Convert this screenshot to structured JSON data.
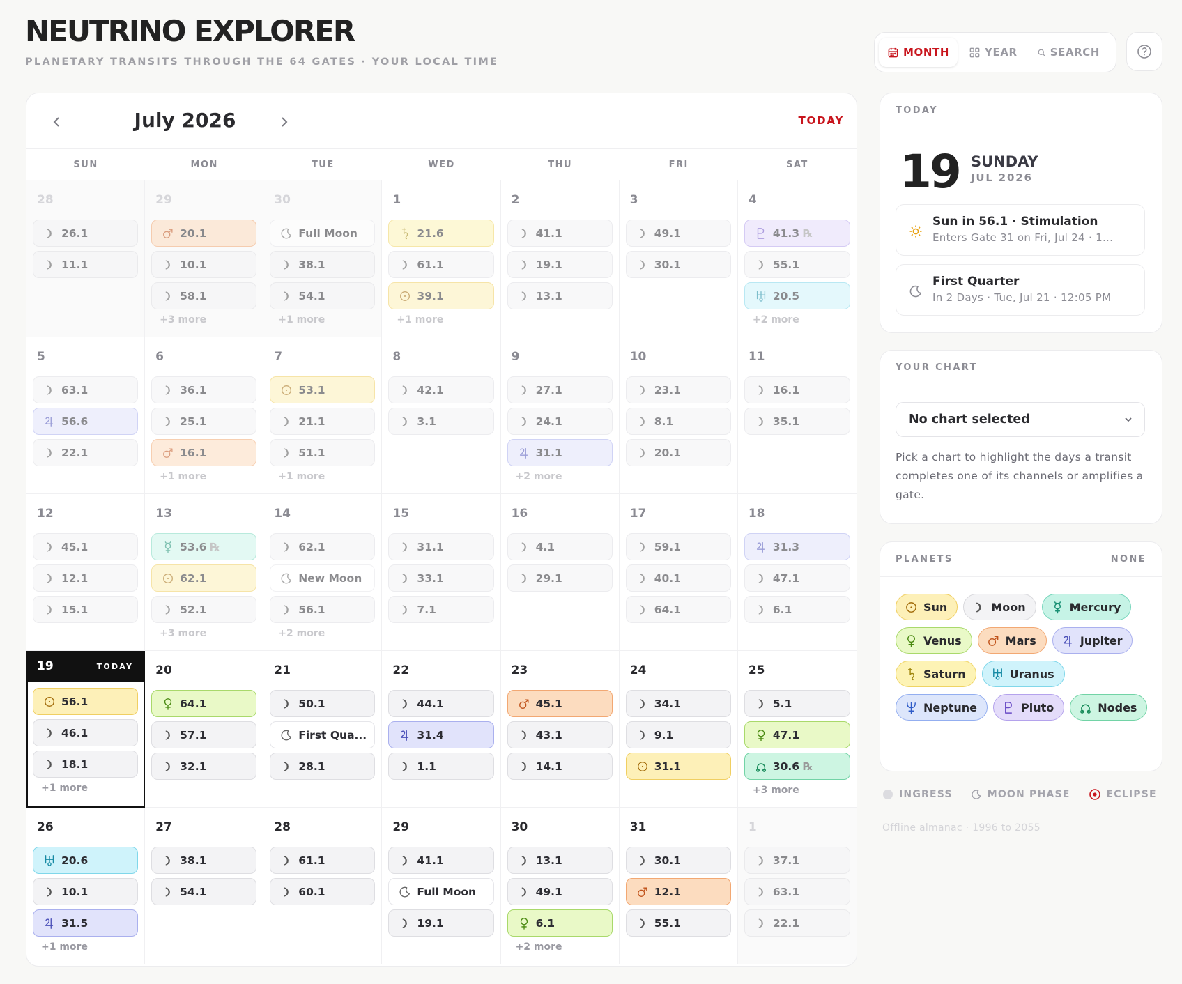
{
  "app": {
    "title": "NEUTRINO EXPLORER",
    "subtitle": "PLANETARY TRANSITS THROUGH THE 64 GATES · YOUR LOCAL TIME"
  },
  "view_tabs": [
    {
      "label": "MONTH",
      "icon": "calendar-icon",
      "active": true
    },
    {
      "label": "YEAR",
      "icon": "grid-icon",
      "active": false
    },
    {
      "label": "SEARCH",
      "icon": "search-icon",
      "active": false
    }
  ],
  "help_icon": "help-icon",
  "calendar": {
    "month_label": "July 2026",
    "today_button": "TODAY",
    "weekdays": [
      "SUN",
      "MON",
      "TUE",
      "WED",
      "THU",
      "FRI",
      "SAT"
    ],
    "today_tag": "TODAY",
    "cells": [
      {
        "day": "28",
        "state": "other",
        "chips": [
          {
            "p": "moon",
            "t": "26.1"
          },
          {
            "p": "moon",
            "t": "11.1"
          }
        ],
        "more": ""
      },
      {
        "day": "29",
        "state": "other",
        "chips": [
          {
            "p": "mars",
            "t": "20.1"
          },
          {
            "p": "moon",
            "t": "10.1"
          },
          {
            "p": "moon",
            "t": "58.1"
          }
        ],
        "more": "+3 more"
      },
      {
        "day": "30",
        "state": "other",
        "chips": [
          {
            "p": "phase",
            "t": "Full Moon"
          },
          {
            "p": "moon",
            "t": "38.1"
          },
          {
            "p": "moon",
            "t": "54.1"
          }
        ],
        "more": "+1 more"
      },
      {
        "day": "1",
        "state": "past",
        "chips": [
          {
            "p": "saturn",
            "t": "21.6"
          },
          {
            "p": "moon",
            "t": "61.1"
          },
          {
            "p": "sun",
            "t": "39.1"
          }
        ],
        "more": "+1 more"
      },
      {
        "day": "2",
        "state": "past",
        "chips": [
          {
            "p": "moon",
            "t": "41.1"
          },
          {
            "p": "moon",
            "t": "19.1"
          },
          {
            "p": "moon",
            "t": "13.1"
          }
        ],
        "more": ""
      },
      {
        "day": "3",
        "state": "past",
        "chips": [
          {
            "p": "moon",
            "t": "49.1"
          },
          {
            "p": "moon",
            "t": "30.1"
          }
        ],
        "more": ""
      },
      {
        "day": "4",
        "state": "past",
        "chips": [
          {
            "p": "pluto",
            "t": "41.3",
            "rx": "℞"
          },
          {
            "p": "moon",
            "t": "55.1"
          },
          {
            "p": "uranus",
            "t": "20.5"
          }
        ],
        "more": "+2 more"
      },
      {
        "day": "5",
        "state": "past",
        "chips": [
          {
            "p": "moon",
            "t": "63.1"
          },
          {
            "p": "jupiter",
            "t": "56.6"
          },
          {
            "p": "moon",
            "t": "22.1"
          }
        ],
        "more": ""
      },
      {
        "day": "6",
        "state": "past",
        "chips": [
          {
            "p": "moon",
            "t": "36.1"
          },
          {
            "p": "moon",
            "t": "25.1"
          },
          {
            "p": "mars",
            "t": "16.1"
          }
        ],
        "more": "+1 more"
      },
      {
        "day": "7",
        "state": "past",
        "chips": [
          {
            "p": "sun",
            "t": "53.1"
          },
          {
            "p": "moon",
            "t": "21.1"
          },
          {
            "p": "moon",
            "t": "51.1"
          }
        ],
        "more": "+1 more"
      },
      {
        "day": "8",
        "state": "past",
        "chips": [
          {
            "p": "moon",
            "t": "42.1"
          },
          {
            "p": "moon",
            "t": "3.1"
          }
        ],
        "more": ""
      },
      {
        "day": "9",
        "state": "past",
        "chips": [
          {
            "p": "moon",
            "t": "27.1"
          },
          {
            "p": "moon",
            "t": "24.1"
          },
          {
            "p": "jupiter",
            "t": "31.1"
          }
        ],
        "more": "+2 more"
      },
      {
        "day": "10",
        "state": "past",
        "chips": [
          {
            "p": "moon",
            "t": "23.1"
          },
          {
            "p": "moon",
            "t": "8.1"
          },
          {
            "p": "moon",
            "t": "20.1"
          }
        ],
        "more": ""
      },
      {
        "day": "11",
        "state": "past",
        "chips": [
          {
            "p": "moon",
            "t": "16.1"
          },
          {
            "p": "moon",
            "t": "35.1"
          }
        ],
        "more": ""
      },
      {
        "day": "12",
        "state": "past",
        "chips": [
          {
            "p": "moon",
            "t": "45.1"
          },
          {
            "p": "moon",
            "t": "12.1"
          },
          {
            "p": "moon",
            "t": "15.1"
          }
        ],
        "more": ""
      },
      {
        "day": "13",
        "state": "past",
        "chips": [
          {
            "p": "mercury",
            "t": "53.6",
            "rx": "℞"
          },
          {
            "p": "sun",
            "t": "62.1"
          },
          {
            "p": "moon",
            "t": "52.1"
          }
        ],
        "more": "+3 more"
      },
      {
        "day": "14",
        "state": "past",
        "chips": [
          {
            "p": "moon",
            "t": "62.1"
          },
          {
            "p": "phase",
            "t": "New Moon"
          },
          {
            "p": "moon",
            "t": "56.1"
          }
        ],
        "more": "+2 more"
      },
      {
        "day": "15",
        "state": "past",
        "chips": [
          {
            "p": "moon",
            "t": "31.1"
          },
          {
            "p": "moon",
            "t": "33.1"
          },
          {
            "p": "moon",
            "t": "7.1"
          }
        ],
        "more": ""
      },
      {
        "day": "16",
        "state": "past",
        "chips": [
          {
            "p": "moon",
            "t": "4.1"
          },
          {
            "p": "moon",
            "t": "29.1"
          }
        ],
        "more": ""
      },
      {
        "day": "17",
        "state": "past",
        "chips": [
          {
            "p": "moon",
            "t": "59.1"
          },
          {
            "p": "moon",
            "t": "40.1"
          },
          {
            "p": "moon",
            "t": "64.1"
          }
        ],
        "more": ""
      },
      {
        "day": "18",
        "state": "past",
        "chips": [
          {
            "p": "jupiter",
            "t": "31.3"
          },
          {
            "p": "moon",
            "t": "47.1"
          },
          {
            "p": "moon",
            "t": "6.1"
          }
        ],
        "more": ""
      },
      {
        "day": "19",
        "state": "today",
        "chips": [
          {
            "p": "sun",
            "t": "56.1"
          },
          {
            "p": "moon",
            "t": "46.1"
          },
          {
            "p": "moon",
            "t": "18.1"
          }
        ],
        "more": "+1 more"
      },
      {
        "day": "20",
        "state": "future",
        "chips": [
          {
            "p": "venus",
            "t": "64.1"
          },
          {
            "p": "moon",
            "t": "57.1"
          },
          {
            "p": "moon",
            "t": "32.1"
          }
        ],
        "more": ""
      },
      {
        "day": "21",
        "state": "future",
        "chips": [
          {
            "p": "moon",
            "t": "50.1"
          },
          {
            "p": "phase",
            "t": "First Qua..."
          },
          {
            "p": "moon",
            "t": "28.1"
          }
        ],
        "more": ""
      },
      {
        "day": "22",
        "state": "future",
        "chips": [
          {
            "p": "moon",
            "t": "44.1"
          },
          {
            "p": "jupiter",
            "t": "31.4"
          },
          {
            "p": "moon",
            "t": "1.1"
          }
        ],
        "more": ""
      },
      {
        "day": "23",
        "state": "future",
        "chips": [
          {
            "p": "mars",
            "t": "45.1"
          },
          {
            "p": "moon",
            "t": "43.1"
          },
          {
            "p": "moon",
            "t": "14.1"
          }
        ],
        "more": ""
      },
      {
        "day": "24",
        "state": "future",
        "chips": [
          {
            "p": "moon",
            "t": "34.1"
          },
          {
            "p": "moon",
            "t": "9.1"
          },
          {
            "p": "sun",
            "t": "31.1"
          }
        ],
        "more": ""
      },
      {
        "day": "25",
        "state": "future",
        "chips": [
          {
            "p": "moon",
            "t": "5.1"
          },
          {
            "p": "venus",
            "t": "47.1"
          },
          {
            "p": "nodes",
            "t": "30.6",
            "rx": "℞"
          }
        ],
        "more": "+3 more"
      },
      {
        "day": "26",
        "state": "future",
        "chips": [
          {
            "p": "uranus",
            "t": "20.6"
          },
          {
            "p": "moon",
            "t": "10.1"
          },
          {
            "p": "jupiter",
            "t": "31.5"
          }
        ],
        "more": "+1 more"
      },
      {
        "day": "27",
        "state": "future",
        "chips": [
          {
            "p": "moon",
            "t": "38.1"
          },
          {
            "p": "moon",
            "t": "54.1"
          }
        ],
        "more": ""
      },
      {
        "day": "28",
        "state": "future",
        "chips": [
          {
            "p": "moon",
            "t": "61.1"
          },
          {
            "p": "moon",
            "t": "60.1"
          }
        ],
        "more": ""
      },
      {
        "day": "29",
        "state": "future",
        "chips": [
          {
            "p": "moon",
            "t": "41.1"
          },
          {
            "p": "phase",
            "t": "Full Moon"
          },
          {
            "p": "moon",
            "t": "19.1"
          }
        ],
        "more": ""
      },
      {
        "day": "30",
        "state": "future",
        "chips": [
          {
            "p": "moon",
            "t": "13.1"
          },
          {
            "p": "moon",
            "t": "49.1"
          },
          {
            "p": "venus",
            "t": "6.1"
          }
        ],
        "more": "+2 more"
      },
      {
        "day": "31",
        "state": "future",
        "chips": [
          {
            "p": "moon",
            "t": "30.1"
          },
          {
            "p": "mars",
            "t": "12.1"
          },
          {
            "p": "moon",
            "t": "55.1"
          }
        ],
        "more": ""
      },
      {
        "day": "1",
        "state": "other-future",
        "chips": [
          {
            "p": "moon",
            "t": "37.1"
          },
          {
            "p": "moon",
            "t": "63.1"
          },
          {
            "p": "moon",
            "t": "22.1"
          }
        ],
        "more": ""
      }
    ]
  },
  "today_panel": {
    "header": "TODAY",
    "day_number": "19",
    "weekday": "SUNDAY",
    "month_year": "JUL 2026",
    "events": [
      {
        "icon": "sun-icon",
        "title": "Sun in 56.1 · Stimulation",
        "detail": "Enters Gate 31 on Fri, Jul 24 · 1..."
      },
      {
        "icon": "moon-phase-icon",
        "title": "First Quarter",
        "detail": "In 2 Days · Tue, Jul 21 · 12:05 PM"
      }
    ]
  },
  "chart_panel": {
    "header": "YOUR CHART",
    "select_value": "No chart selected",
    "hint": "Pick a chart to highlight the days a transit completes one of its channels or amplifies a gate."
  },
  "planets_panel": {
    "header": "PLANETS",
    "none_label": "NONE",
    "planets": [
      {
        "key": "sun",
        "label": "Sun"
      },
      {
        "key": "moon",
        "label": "Moon"
      },
      {
        "key": "mercury",
        "label": "Mercury"
      },
      {
        "key": "venus",
        "label": "Venus"
      },
      {
        "key": "mars",
        "label": "Mars"
      },
      {
        "key": "jupiter",
        "label": "Jupiter"
      },
      {
        "key": "saturn",
        "label": "Saturn"
      },
      {
        "key": "uranus",
        "label": "Uranus"
      },
      {
        "key": "neptune",
        "label": "Neptune"
      },
      {
        "key": "pluto",
        "label": "Pluto"
      },
      {
        "key": "nodes",
        "label": "Nodes"
      }
    ]
  },
  "legend": [
    {
      "icon": "ingress-dot-icon",
      "label": "INGRESS"
    },
    {
      "icon": "moon-phase-icon",
      "label": "MOON PHASE"
    },
    {
      "icon": "eclipse-icon",
      "label": "ECLIPSE"
    }
  ],
  "footer": "Offline almanac · 1996 to 2055",
  "colors": {
    "accent": "#c8151d",
    "sun": "#fdf0b8",
    "mars": "#fcdcbf",
    "jupiter": "#e1e3fb",
    "venus": "#e9f9c7",
    "mercury": "#cdf5ea",
    "uranus": "#cff3fb",
    "pluto": "#e4dcfa",
    "nodes": "#cdf5e2",
    "saturn": "#fdf3b5",
    "neptune": "#dde6fb"
  }
}
